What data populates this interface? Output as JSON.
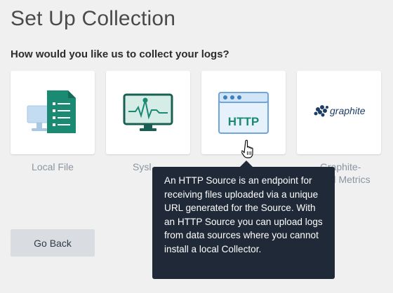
{
  "page": {
    "title": "Set Up Collection",
    "question": "How would you like us to collect your logs?"
  },
  "sources": [
    {
      "id": "local-file",
      "label": "Local File",
      "icon": "local-file-icon"
    },
    {
      "id": "syslog",
      "label": "Syslog",
      "icon": "syslog-monitor-icon"
    },
    {
      "id": "http",
      "label": "HTTP",
      "icon": "http-browser-icon",
      "icon_text": "HTTP"
    },
    {
      "id": "graphite",
      "label": "Graphite-Formatted Metrics",
      "icon": "graphite-logo",
      "logo_text": "graphite"
    }
  ],
  "visible_labels": {
    "local_file": "Local File",
    "syslog_partial": "Sysl",
    "graphite_line1": "Graphite-",
    "graphite_line2": "ed Metrics"
  },
  "tooltip": {
    "text": "An HTTP Source is an endpoint for receiving files uploaded via a unique URL generated for the Source. With an HTTP Source you can upload logs from data sources where you cannot install a local Collector."
  },
  "buttons": {
    "go_back": "Go Back"
  },
  "colors": {
    "accent_teal": "#1b8a73",
    "dark_teal": "#1a5f54",
    "http_blue": "#3f7fbf",
    "tooltip_bg": "#1f2937",
    "label_gray": "#8a95a2"
  }
}
